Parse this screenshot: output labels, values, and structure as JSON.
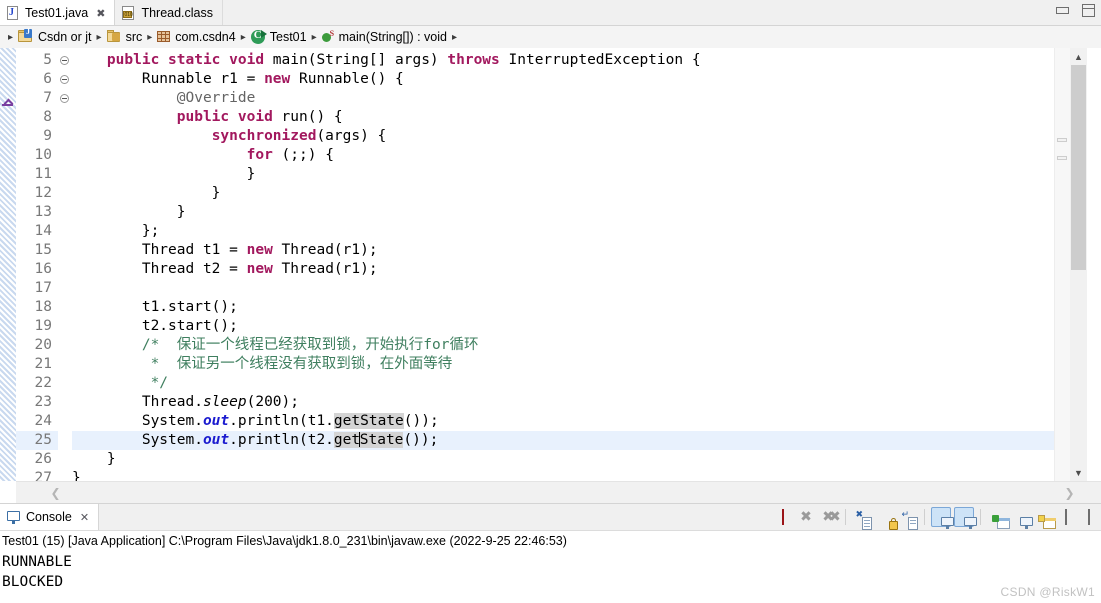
{
  "window": {
    "minimize_label": "Minimize",
    "maximize_label": "Maximize"
  },
  "editor_tabs": [
    {
      "label": "Test01.java",
      "icon": "java-file-icon",
      "active": true,
      "closeable": true
    },
    {
      "label": "Thread.class",
      "icon": "class-file-icon",
      "active": false,
      "closeable": false
    }
  ],
  "breadcrumb": {
    "separator": "▸",
    "items": [
      {
        "label": "Csdn or jt",
        "icon": "java-project-icon"
      },
      {
        "label": "src",
        "icon": "source-folder-icon"
      },
      {
        "label": "com.csdn4",
        "icon": "package-icon"
      },
      {
        "label": "Test01",
        "icon": "class-icon"
      },
      {
        "label": "main(String[]) : void",
        "icon": "method-icon"
      }
    ]
  },
  "code": {
    "first_line_number": 5,
    "highlighted_line": 25,
    "lines": [
      {
        "n": 5,
        "fold": true,
        "html": "    <span class=\"kw\">public static void</span> main(String[] args) <span class=\"kw\">throws</span> InterruptedException {"
      },
      {
        "n": 6,
        "fold": true,
        "html": "        Runnable r1 = <span class=\"kw\">new</span> Runnable() {"
      },
      {
        "n": 7,
        "fold": true,
        "html": "            <span class=\"ann\">@Override</span>"
      },
      {
        "n": 8,
        "fold": false,
        "html": "            <span class=\"kw\">public void</span> run() {"
      },
      {
        "n": 9,
        "fold": false,
        "html": "                <span class=\"kw\">synchronized</span>(args) {"
      },
      {
        "n": 10,
        "fold": false,
        "html": "                    <span class=\"kw\">for</span> (;;) {"
      },
      {
        "n": 11,
        "fold": false,
        "html": "                    }"
      },
      {
        "n": 12,
        "fold": false,
        "html": "                }"
      },
      {
        "n": 13,
        "fold": false,
        "html": "            }"
      },
      {
        "n": 14,
        "fold": false,
        "html": "        };"
      },
      {
        "n": 15,
        "fold": false,
        "html": "        Thread t1 = <span class=\"kw\">new</span> Thread(r1);"
      },
      {
        "n": 16,
        "fold": false,
        "html": "        Thread t2 = <span class=\"kw\">new</span> Thread(r1);"
      },
      {
        "n": 17,
        "fold": false,
        "html": ""
      },
      {
        "n": 18,
        "fold": false,
        "html": "        t1.start();"
      },
      {
        "n": 19,
        "fold": false,
        "html": "        t2.start();"
      },
      {
        "n": 20,
        "fold": false,
        "html": "        <span class=\"cmt\">/*  保证一个线程已经获取到锁，开始执行for循环</span>"
      },
      {
        "n": 21,
        "fold": false,
        "html": "        <span class=\"cmt\"> *  保证另一个线程没有获取到锁，在外面等待</span>"
      },
      {
        "n": 22,
        "fold": false,
        "html": "        <span class=\"cmt\"> */</span>"
      },
      {
        "n": 23,
        "fold": false,
        "html": "        Thread.<span class=\"statp\">sleep</span>(200);"
      },
      {
        "n": 24,
        "fold": false,
        "html": "        System.<span class=\"stat\">out</span>.println(t1.<span class=\"occ\">getState</span>());"
      },
      {
        "n": 25,
        "fold": false,
        "html": "        System.<span class=\"stat\">out</span>.println(t2.<span class=\"occ\">get</span><span class=\"caret\"></span><span class=\"occ\">State</span>());"
      },
      {
        "n": 26,
        "fold": false,
        "html": "    }"
      },
      {
        "n": 27,
        "fold": false,
        "html": "}"
      }
    ]
  },
  "console": {
    "tab_label": "Console",
    "tab_icon": "console-icon",
    "close_glyph": "✕",
    "header": "Test01 (15) [Java Application] C:\\Program Files\\Java\\jdk1.8.0_231\\bin\\javaw.exe  (2022-9-25 22:46:53)",
    "output": [
      "RUNNABLE",
      "BLOCKED"
    ],
    "toolbar": [
      {
        "name": "terminate-button",
        "icon": "stop-icon",
        "active": false
      },
      {
        "name": "remove-launch-button",
        "icon": "remove-launch-icon",
        "active": false
      },
      {
        "name": "remove-all-terminated-button",
        "icon": "remove-all-terminated-icon",
        "active": false
      },
      {
        "name": "clear-console-button",
        "icon": "clear-console-icon",
        "active": false
      },
      {
        "name": "scroll-lock-button",
        "icon": "lock-icon",
        "active": false
      },
      {
        "name": "word-wrap-button",
        "icon": "word-wrap-icon",
        "active": false
      },
      {
        "name": "show-console-on-output-button",
        "icon": "console-output-icon",
        "active": true
      },
      {
        "name": "show-console-on-error-button",
        "icon": "console-error-icon",
        "active": true
      },
      {
        "name": "pin-console-button",
        "icon": "pin-console-icon",
        "active": false
      },
      {
        "name": "display-selected-console-button",
        "icon": "display-console-icon",
        "active": false
      },
      {
        "name": "open-console-button",
        "icon": "open-console-icon",
        "active": false
      },
      {
        "name": "minimize-button",
        "icon": "minimize-icon",
        "active": false
      },
      {
        "name": "maximize-button",
        "icon": "maximize-icon",
        "active": false
      }
    ]
  },
  "watermark": "CSDN @RiskW1",
  "colors": {
    "keyword": "#a2185e",
    "comment": "#3f7f5f",
    "static_field": "#1b1bcf",
    "occurrence_highlight": "#d4d4d4",
    "current_line": "#e8f1fd",
    "tab_active_bg": "#ffffff",
    "chrome_bg": "#f0f0f0",
    "toggle_on_bg": "#cde3f7"
  }
}
